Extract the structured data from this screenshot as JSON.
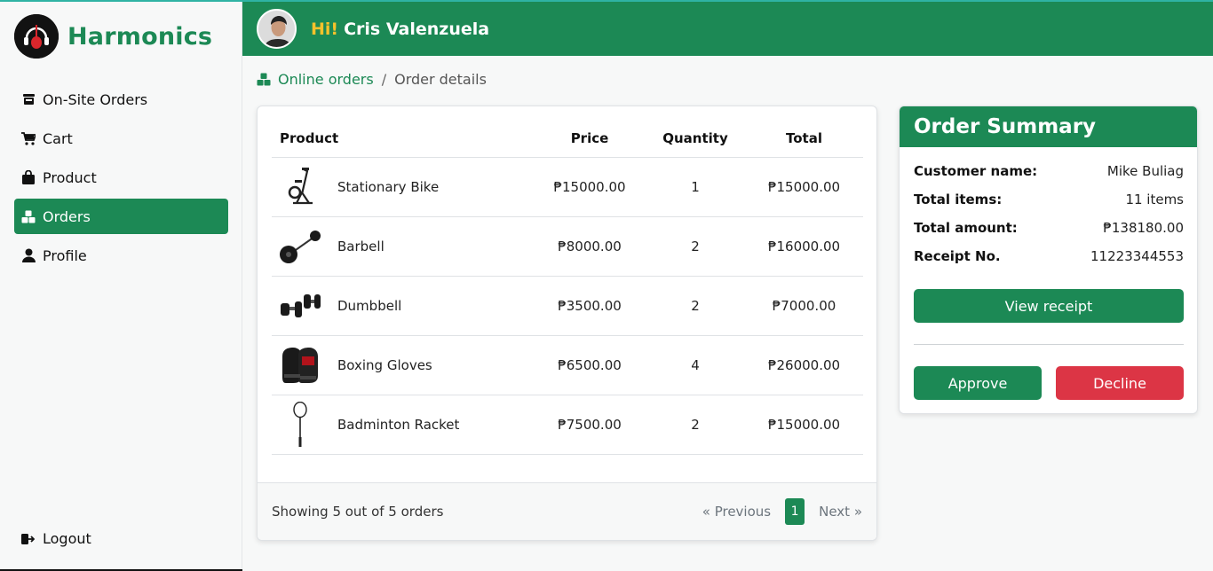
{
  "app": {
    "brand": "Harmonics"
  },
  "sidebar": {
    "items": [
      {
        "label": "On-Site Orders",
        "icon": "store-icon"
      },
      {
        "label": "Cart",
        "icon": "cart-icon"
      },
      {
        "label": "Product",
        "icon": "bag-icon"
      },
      {
        "label": "Orders",
        "icon": "boxes-icon",
        "active": true
      },
      {
        "label": "Profile",
        "icon": "person-icon"
      }
    ],
    "logout": "Logout"
  },
  "header": {
    "hi": "Hi!",
    "user_name": "Cris Valenzuela"
  },
  "breadcrumb": {
    "parent": "Online orders",
    "separator": "/",
    "current": "Order details"
  },
  "table": {
    "headers": {
      "product": "Product",
      "price": "Price",
      "quantity": "Quantity",
      "total": "Total"
    },
    "rows": [
      {
        "product": "Stationary Bike",
        "price": "₱15000.00",
        "quantity": "1",
        "total": "₱15000.00"
      },
      {
        "product": "Barbell",
        "price": "₱8000.00",
        "quantity": "2",
        "total": "₱16000.00"
      },
      {
        "product": "Dumbbell",
        "price": "₱3500.00",
        "quantity": "2",
        "total": "₱7000.00"
      },
      {
        "product": "Boxing Gloves",
        "price": "₱6500.00",
        "quantity": "4",
        "total": "₱26000.00"
      },
      {
        "product": "Badminton Racket",
        "price": "₱7500.00",
        "quantity": "2",
        "total": "₱15000.00"
      }
    ],
    "showing": "Showing 5 out of 5 orders",
    "pagination": {
      "previous": "« Previous",
      "current_page": "1",
      "next": "Next »"
    }
  },
  "summary": {
    "title": "Order Summary",
    "customer_label": "Customer name:",
    "customer_value": "Mike Buliag",
    "items_label": "Total items:",
    "items_value": "11 items",
    "amount_label": "Total amount:",
    "amount_value": "₱138180.00",
    "receipt_label": "Receipt No.",
    "receipt_value": "11223344553",
    "view_receipt": "View receipt",
    "approve": "Approve",
    "decline": "Decline"
  },
  "colors": {
    "brand_green": "#1c8955",
    "decline_red": "#dc3545",
    "greeting_yellow": "#f6c22b"
  }
}
